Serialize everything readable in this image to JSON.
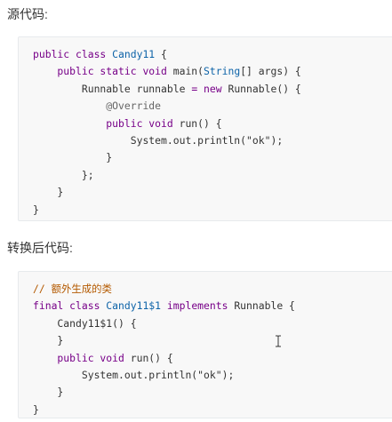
{
  "headings": {
    "source": "源代码:",
    "converted": "转换后代码:"
  },
  "source_code": {
    "lines": [
      [
        {
          "t": "kw",
          "v": "public class "
        },
        {
          "t": "cls",
          "v": "Candy11"
        },
        {
          "t": "plain",
          "v": " {"
        }
      ],
      [
        {
          "t": "kw",
          "v": "    public static void "
        },
        {
          "t": "plain",
          "v": "main("
        },
        {
          "t": "cls",
          "v": "String"
        },
        {
          "t": "plain",
          "v": "[] args) {"
        }
      ],
      [
        {
          "t": "plain",
          "v": "        Runnable runnable "
        },
        {
          "t": "kw",
          "v": "= new "
        },
        {
          "t": "plain",
          "v": "Runnable() {"
        }
      ],
      [
        {
          "t": "ann",
          "v": "            @Override"
        }
      ],
      [
        {
          "t": "kw",
          "v": "            public void "
        },
        {
          "t": "plain",
          "v": "run() {"
        }
      ],
      [
        {
          "t": "plain",
          "v": "                System.out.println("
        },
        {
          "t": "str",
          "v": "\"ok\""
        },
        {
          "t": "plain",
          "v": ");"
        }
      ],
      [
        {
          "t": "plain",
          "v": "            }"
        }
      ],
      [
        {
          "t": "plain",
          "v": "        };"
        }
      ],
      [
        {
          "t": "plain",
          "v": "    }"
        }
      ],
      [
        {
          "t": "plain",
          "v": "}"
        }
      ]
    ]
  },
  "converted_code": {
    "lines": [
      [
        {
          "t": "cm",
          "v": "// 额外生成的类"
        }
      ],
      [
        {
          "t": "kw",
          "v": "final class "
        },
        {
          "t": "cls",
          "v": "Candy11$1"
        },
        {
          "t": "kw",
          "v": " implements "
        },
        {
          "t": "plain",
          "v": "Runnable {"
        }
      ],
      [
        {
          "t": "plain",
          "v": "    Candy11$1() {"
        }
      ],
      [
        {
          "t": "plain",
          "v": "    }"
        }
      ],
      [
        {
          "t": "kw",
          "v": "    public void "
        },
        {
          "t": "plain",
          "v": "run() {"
        }
      ],
      [
        {
          "t": "plain",
          "v": "        System.out.println("
        },
        {
          "t": "str",
          "v": "\"ok\""
        },
        {
          "t": "plain",
          "v": ");"
        }
      ],
      [
        {
          "t": "plain",
          "v": "    }"
        }
      ],
      [
        {
          "t": "plain",
          "v": "}"
        }
      ]
    ]
  },
  "icons": {
    "cursor": "text-cursor-icon"
  }
}
